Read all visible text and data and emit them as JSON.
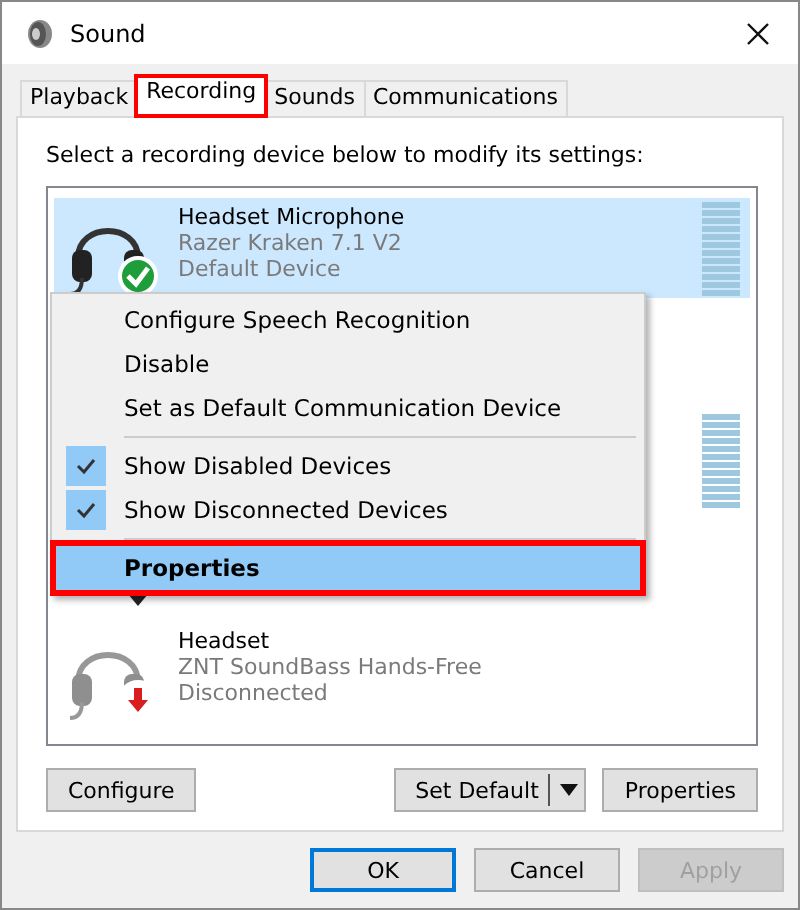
{
  "window": {
    "title": "Sound"
  },
  "tabs": [
    {
      "label": "Playback",
      "selected": false,
      "annotated": false
    },
    {
      "label": "Recording",
      "selected": true,
      "annotated": true
    },
    {
      "label": "Sounds",
      "selected": false,
      "annotated": false
    },
    {
      "label": "Communications",
      "selected": false,
      "annotated": false
    }
  ],
  "instruction": "Select a recording device below to modify its settings:",
  "devices": [
    {
      "kind": "full",
      "name": "Headset Microphone",
      "model": "Razer Kraken 7.1 V2",
      "status": "Default Device",
      "badge": {
        "kind": "check"
      },
      "meter": true,
      "selected": true
    },
    {
      "kind": "covered",
      "meter": false,
      "selected": false
    },
    {
      "kind": "covered",
      "meter": true,
      "selected": false
    },
    {
      "kind": "covered",
      "badge": {
        "kind": "down-dark"
      },
      "meter": false,
      "selected": false
    },
    {
      "kind": "full",
      "name": "Headset",
      "model": "ZNT SoundBass Hands-Free",
      "status": "Disconnected",
      "badge": {
        "kind": "down-red"
      },
      "meter": false,
      "selected": false
    }
  ],
  "context_menu": [
    {
      "kind": "item",
      "label": "Configure Speech Recognition",
      "checked": false,
      "bold": false,
      "selected": false,
      "annotated": false
    },
    {
      "kind": "item",
      "label": "Disable",
      "checked": false,
      "bold": false,
      "selected": false,
      "annotated": false
    },
    {
      "kind": "item",
      "label": "Set as Default Communication Device",
      "checked": false,
      "bold": false,
      "selected": false,
      "annotated": false
    },
    {
      "kind": "separator"
    },
    {
      "kind": "item",
      "label": "Show Disabled Devices",
      "checked": true,
      "bold": false,
      "selected": false,
      "annotated": false
    },
    {
      "kind": "item",
      "label": "Show Disconnected Devices",
      "checked": true,
      "bold": false,
      "selected": false,
      "annotated": false
    },
    {
      "kind": "separator"
    },
    {
      "kind": "item",
      "label": "Properties",
      "checked": false,
      "bold": true,
      "selected": true,
      "annotated": true
    }
  ],
  "panel_buttons": {
    "configure": "Configure",
    "set_default": "Set Default",
    "properties": "Properties"
  },
  "dialog_buttons": [
    {
      "label": "OK",
      "default": true,
      "disabled": false
    },
    {
      "label": "Cancel",
      "default": false,
      "disabled": false
    },
    {
      "label": "Apply",
      "default": false,
      "disabled": true
    }
  ]
}
